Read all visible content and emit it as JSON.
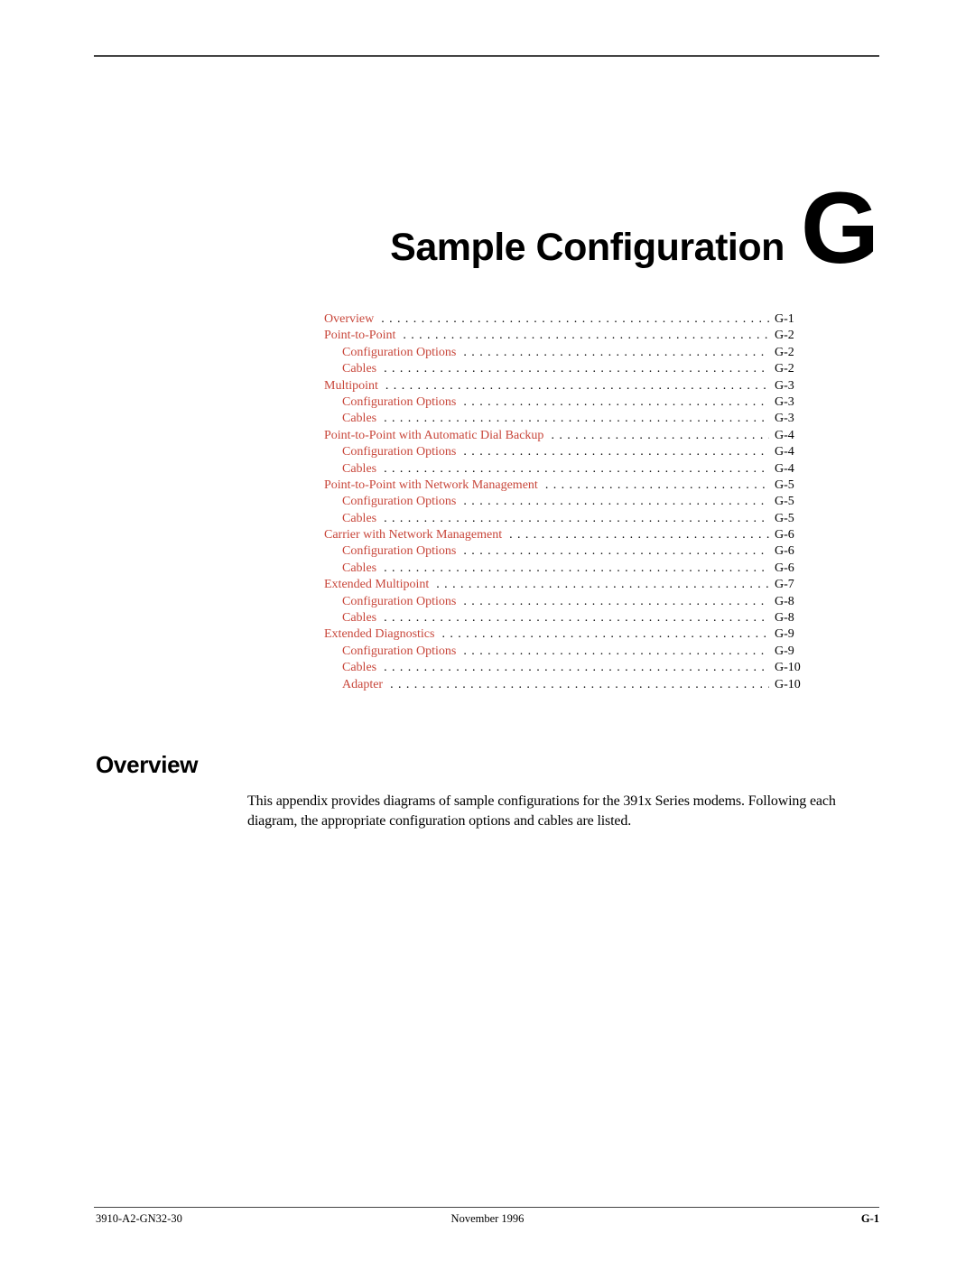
{
  "header": {
    "chapter_title": "Sample Configuration",
    "chapter_letter": "G"
  },
  "toc": {
    "link_color": "#c8463a",
    "entries": [
      {
        "label": "Overview",
        "page": "G-1",
        "level": 1
      },
      {
        "label": "Point-to-Point",
        "page": "G-2",
        "level": 1
      },
      {
        "label": "Configuration Options",
        "page": "G-2",
        "level": 2
      },
      {
        "label": "Cables",
        "page": "G-2",
        "level": 2
      },
      {
        "label": "Multipoint",
        "page": "G-3",
        "level": 1
      },
      {
        "label": "Configuration Options",
        "page": "G-3",
        "level": 2
      },
      {
        "label": "Cables",
        "page": "G-3",
        "level": 2
      },
      {
        "label": "Point-to-Point with Automatic Dial Backup",
        "page": "G-4",
        "level": 1
      },
      {
        "label": "Configuration Options",
        "page": "G-4",
        "level": 2
      },
      {
        "label": "Cables",
        "page": "G-4",
        "level": 2
      },
      {
        "label": "Point-to-Point with Network Management",
        "page": "G-5",
        "level": 1
      },
      {
        "label": "Configuration Options",
        "page": "G-5",
        "level": 2
      },
      {
        "label": "Cables",
        "page": "G-5",
        "level": 2
      },
      {
        "label": "Carrier with Network Management",
        "page": "G-6",
        "level": 1
      },
      {
        "label": "Configuration Options",
        "page": "G-6",
        "level": 2
      },
      {
        "label": "Cables",
        "page": "G-6",
        "level": 2
      },
      {
        "label": "Extended Multipoint",
        "page": "G-7",
        "level": 1
      },
      {
        "label": "Configuration Options",
        "page": "G-8",
        "level": 2
      },
      {
        "label": "Cables",
        "page": "G-8",
        "level": 2
      },
      {
        "label": "Extended Diagnostics",
        "page": "G-9",
        "level": 1
      },
      {
        "label": "Configuration Options",
        "page": "G-9",
        "level": 2
      },
      {
        "label": "Cables",
        "page": "G-10",
        "level": 2
      },
      {
        "label": "Adapter",
        "page": "G-10",
        "level": 2
      }
    ]
  },
  "overview": {
    "heading": "Overview",
    "body": "This appendix provides diagrams of sample configurations for the 391x Series modems. Following each diagram, the appropriate configuration options and cables are listed."
  },
  "footer": {
    "doc_number": "3910-A2-GN32-30",
    "date": "November 1996",
    "page_number": "G-1"
  }
}
